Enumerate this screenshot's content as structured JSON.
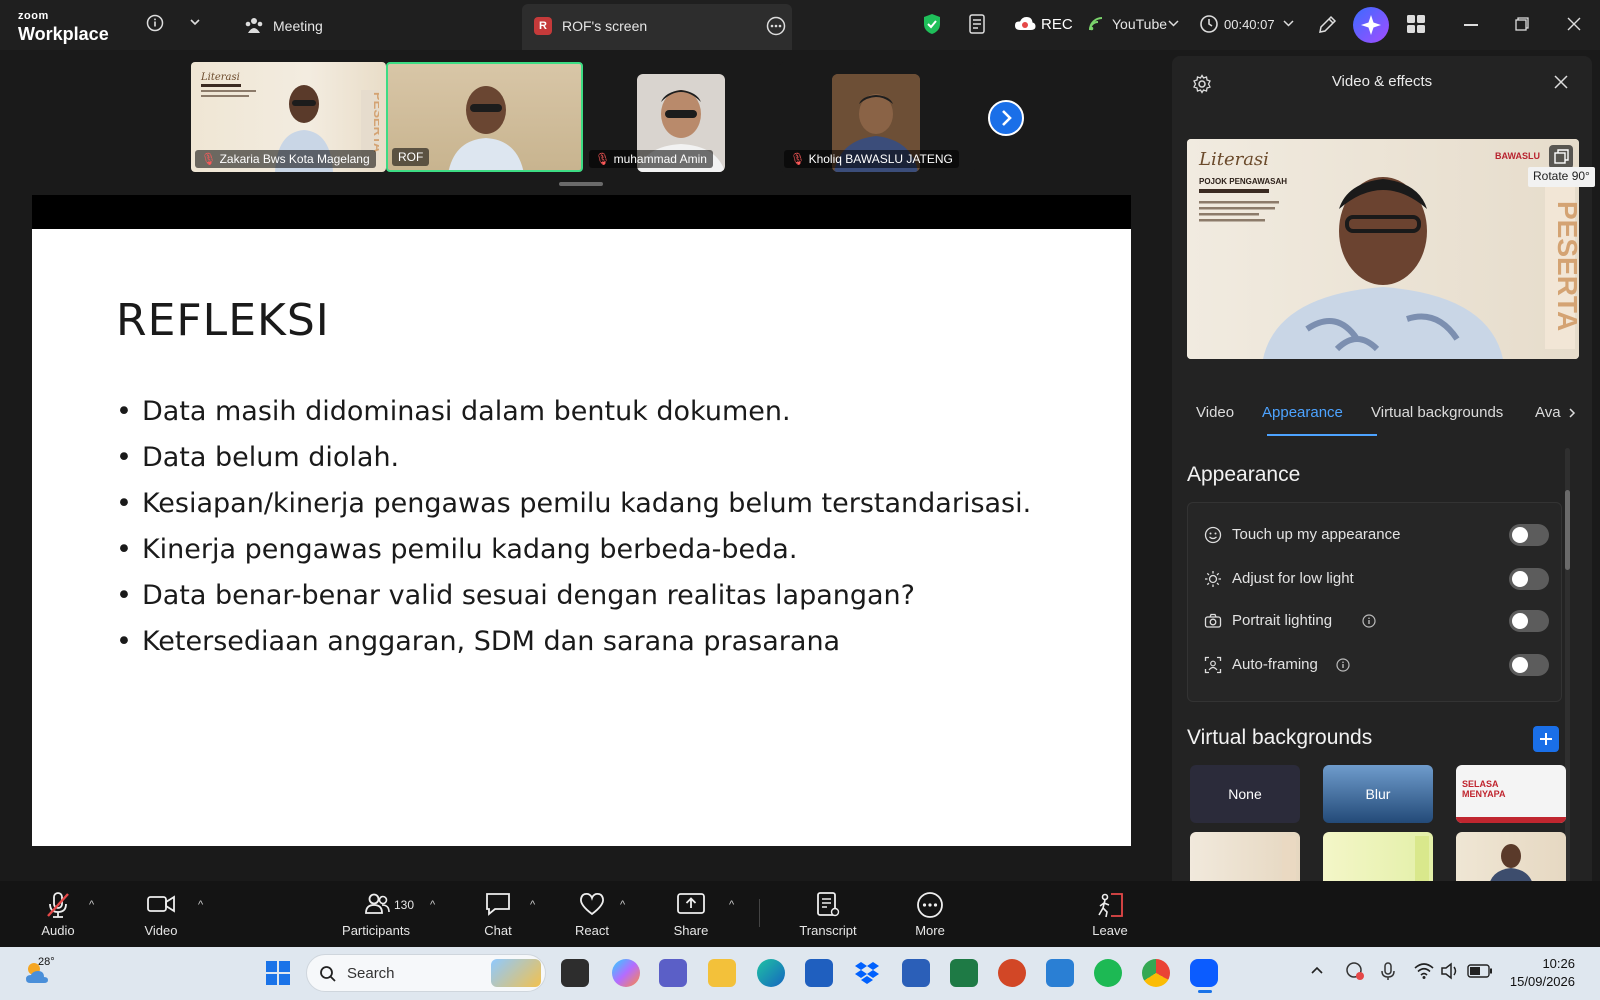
{
  "app": {
    "brand_small": "zoom",
    "brand_big": "Workplace",
    "meeting_tab": "Meeting",
    "screen_tab": "ROF's screen",
    "screen_tab_badge": "R",
    "rec_label": "REC",
    "stream_label": "YouTube",
    "timer": "00:40:07"
  },
  "participants_strip": [
    {
      "name": "Zakaria Bws Kota Magelang",
      "muted": true
    },
    {
      "name": "ROF",
      "muted": false,
      "active_speaker": true
    },
    {
      "name": "muhammad Amin",
      "muted": true
    },
    {
      "name": "Kholiq BAWASLU JATENG",
      "muted": true
    }
  ],
  "slide": {
    "title": "REFLEKSI",
    "bullets": [
      "Data masih didominasi dalam bentuk dokumen.",
      "Data belum diolah.",
      "Kesiapan/kinerja pengawas pemilu kadang belum terstandarisasi.",
      "Kinerja pengawas pemilu kadang berbeda-beda.",
      "Data benar-benar valid sesuai dengan realitas lapangan?",
      "Ketersediaan anggaran, SDM dan sarana prasarana"
    ]
  },
  "panel": {
    "title": "Video & effects",
    "rotate_tooltip": "Rotate 90°",
    "preview_banner": {
      "heading": "Literasi",
      "sub": "POJOK PENGAWASAH",
      "brand": "BAWASLU",
      "vertical": "PESERTA"
    },
    "tabs": [
      "Video",
      "Appearance",
      "Virtual backgrounds",
      "Ava"
    ],
    "active_tab": "Appearance",
    "appearance_heading": "Appearance",
    "appearance_options": [
      {
        "label": "Touch up my appearance",
        "icon": "face-icon",
        "info": false,
        "on": false
      },
      {
        "label": "Adjust for low light",
        "icon": "sun-icon",
        "info": false,
        "on": false
      },
      {
        "label": "Portrait lighting",
        "icon": "camera-light-icon",
        "info": true,
        "on": false
      },
      {
        "label": "Auto-framing",
        "icon": "frame-icon",
        "info": true,
        "on": false
      }
    ],
    "vb_heading": "Virtual backgrounds",
    "vb_items": [
      "None",
      "Blur",
      "SELASA MENYAPA",
      "",
      "",
      ""
    ]
  },
  "toolbar": {
    "audio": "Audio",
    "video": "Video",
    "participants": "Participants",
    "participants_count": "130",
    "chat": "Chat",
    "react": "React",
    "share": "Share",
    "transcript": "Transcript",
    "more": "More",
    "leave": "Leave"
  },
  "taskbar": {
    "weather": "28°",
    "search_placeholder": "Search",
    "time": "10:26",
    "date": "15/09/2026"
  },
  "colors": {
    "accent": "#4da3ff",
    "active_speaker_border": "#3ddc84",
    "rec": "#e54848"
  }
}
